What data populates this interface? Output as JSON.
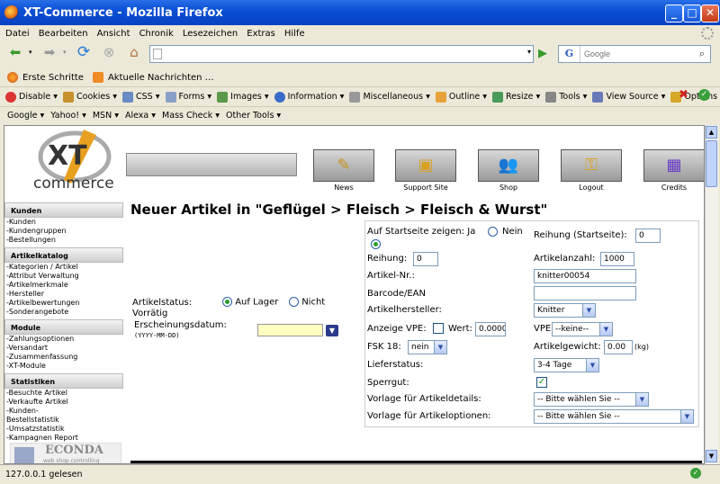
{
  "window": {
    "title": "XT-Commerce - Mozilla Firefox"
  },
  "menu": [
    "Datei",
    "Bearbeiten",
    "Ansicht",
    "Chronik",
    "Lesezeichen",
    "Extras",
    "Hilfe"
  ],
  "search": {
    "engine": "G",
    "placeholder": "Google"
  },
  "bookmarks": [
    "Erste Schritte",
    "Aktuelle Nachrichten …"
  ],
  "webdev": [
    "Disable ▾",
    "Cookies ▾",
    "CSS ▾",
    "Forms ▾",
    "Images ▾",
    "Information ▾",
    "Miscellaneous ▾",
    "Outline ▾",
    "Resize ▾",
    "Tools ▾",
    "View Source ▾",
    "Options ▾"
  ],
  "searchtoolbar": [
    "Google ▾",
    "Yahoo! ▾",
    "MSN ▾",
    "Alexa ▾",
    "Mass Check ▾",
    "Other Tools ▾"
  ],
  "status": {
    "text": "127.0.0.1 gelesen"
  },
  "page": {
    "logo_xt": "XT",
    "logo_commerce": "commerce",
    "nav": [
      "News",
      "Support Site",
      "Shop",
      "Logout",
      "Credits"
    ],
    "sidebar": [
      {
        "title": "Kunden",
        "items": [
          "-Kunden",
          "-Kundengruppen",
          "-Bestellungen"
        ]
      },
      {
        "title": "Artikelkatalog",
        "items": [
          "-Kategorien / Artikel",
          "-Attribut Verwaltung",
          "-Artikelmerkmale",
          "-Hersteller",
          "-Artikelbewertungen",
          "-Sonderangebote"
        ]
      },
      {
        "title": "Module",
        "items": [
          "-Zahlungsoptionen",
          "-Versandart",
          "-Zusammenfassung",
          "-XT-Module"
        ]
      },
      {
        "title": "Statistiken",
        "items": [
          "-Besuchte Artikel",
          "-Verkaufte Artikel",
          "-Kunden-",
          "Bestellstatistik",
          "-Umsatzstatistik",
          "-Kampagnen Report"
        ]
      }
    ],
    "econda": "ECONDA",
    "econda_sub": "web shop controlling",
    "title": "Neuer Artikel in \"Geflügel > Fleisch > Fleisch & Wurst\"",
    "left_form": {
      "status_label": "Artikelstatus:",
      "status_label2": "Vorrätig",
      "on_stock": "Auf Lager",
      "not": "Nicht",
      "date_label": "Erscheinungsdatum:",
      "date_format": "(YYYY-MM-DD)"
    },
    "form": {
      "startseite_label": "Auf Startseite zeigen: Ja",
      "startseite_nein": "Nein",
      "reihung_start_label": "Reihung (Startseite):",
      "reihung_start_val": "0",
      "reihung_label": "Reihung:",
      "reihung_val": "0",
      "anzahl_label": "Artikelanzahl:",
      "anzahl_val": "1000",
      "nr_label": "Artikel-Nr.:",
      "nr_val": "knitter00054",
      "barcode_label": "Barcode/EAN",
      "hersteller_label": "Artikelhersteller:",
      "hersteller_val": "Knitter",
      "vpe_label": "Anzeige VPE:",
      "wert_label": "Wert:",
      "wert_val": "0.0000",
      "vpe2_label": "VPE",
      "vpe2_val": "--keine--",
      "fsk_label": "FSK 18:",
      "fsk_val": "nein",
      "gewicht_label": "Artikelgewicht:",
      "gewicht_val": "0.00",
      "gewicht_unit": "(kg)",
      "liefer_label": "Lieferstatus:",
      "liefer_val": "3-4 Tage",
      "sperr_label": "Sperrgut:",
      "vorlage1_label": "Vorlage für Artikeldetails:",
      "vorlage1_val": "-- Bitte wählen Sie --",
      "vorlage2_label": "Vorlage für Artikeloptionen:",
      "vorlage2_val": "-- Bitte wählen Sie --"
    }
  }
}
